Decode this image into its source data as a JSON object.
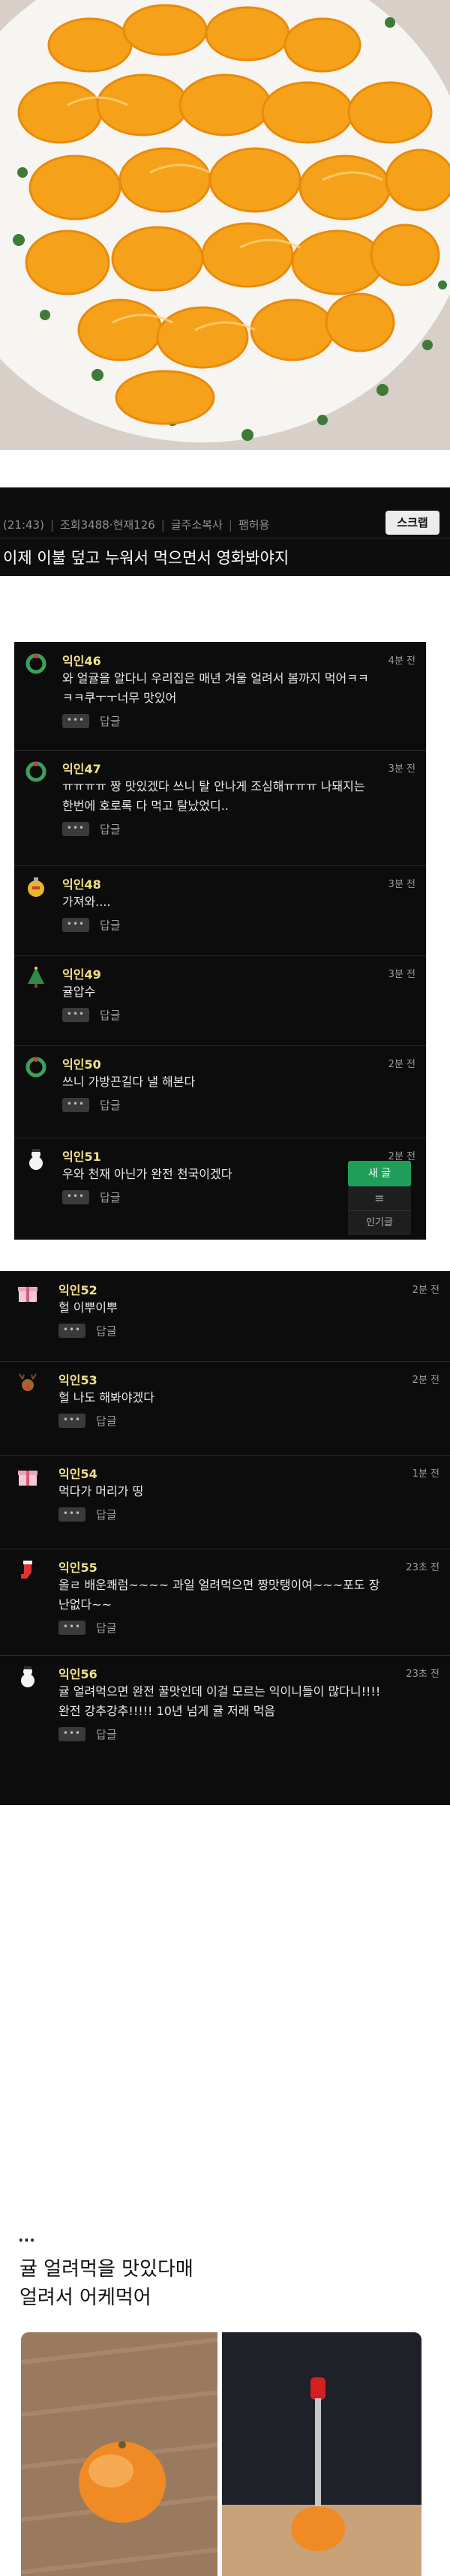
{
  "header": {
    "time": "(21:43)",
    "views": "조회3488",
    "members": "현재126",
    "copy_address": "글주소복사",
    "report": "팸허용",
    "scrap": "스크랩",
    "title": "이제 이불 덮고 누워서 먹으면서 영화봐야지"
  },
  "comments_a": [
    {
      "name": "익인46",
      "time": "4분 전",
      "lines": [
        "와 얼귤을 알다니 우리집은 매년 겨울 얼려서 봄까지 먹어ㅋㅋ",
        "ㅋㅋ쿠ㅜㅜ너무 맛있어"
      ],
      "avatar": "wreath-icon",
      "more": "•••",
      "reply": "답글"
    },
    {
      "name": "익인47",
      "time": "3분 전",
      "lines": [
        "ㅠㅠㅠㅠ 짱 맛있겠다 쓰니 탈 안나게 조심해ㅠㅠㅠ 나돼지는",
        "한번에 호로록 다 먹고 탈났었디.."
      ],
      "avatar": "wreath-icon",
      "more": "•••",
      "reply": "답글"
    },
    {
      "name": "익인48",
      "time": "3분 전",
      "lines": [
        "가져와...."
      ],
      "avatar": "ornament-icon",
      "more": "•••",
      "reply": "답글"
    },
    {
      "name": "익인49",
      "time": "3분 전",
      "lines": [
        "귤압수"
      ],
      "avatar": "tree-icon",
      "more": "•••",
      "reply": "답글"
    },
    {
      "name": "익인50",
      "time": "2분 전",
      "lines": [
        "쓰니 가방끈길다 낼 해본다"
      ],
      "avatar": "wreath-icon",
      "more": "•••",
      "reply": "답글"
    },
    {
      "name": "익인51",
      "time": "2분 전",
      "lines": [
        "우와 천재 아닌가 완전 천국이겠다"
      ],
      "avatar": "snowman-icon",
      "more": "•••",
      "reply": "답글"
    }
  ],
  "comments_b": [
    {
      "name": "익인52",
      "time": "2분 전",
      "lines": [
        "헐 이뿌이뿌"
      ],
      "avatar": "gift-icon",
      "more": "•••",
      "reply": "답글"
    },
    {
      "name": "익인53",
      "time": "2분 전",
      "lines": [
        "헐 나도 해봐야겠다"
      ],
      "avatar": "reindeer-icon",
      "more": "•••",
      "reply": "답글"
    },
    {
      "name": "익인54",
      "time": "1분 전",
      "lines": [
        "먹다가 머리가 띵"
      ],
      "avatar": "gift-icon",
      "more": "•••",
      "reply": "답글"
    },
    {
      "name": "익인55",
      "time": "23초 전",
      "lines": [
        "올ㄹ 배운쾌럼~~~~ 과일 얼려먹으면 짱맛탱이여~~~포도 장",
        "난없다~~"
      ],
      "avatar": "stocking-icon",
      "more": "•••",
      "reply": "답글"
    },
    {
      "name": "익인56",
      "time": "23초 전",
      "lines": [
        "귤 얼려먹으면 완전 꿀맛인데 이걸 모르는 익이니들이 많다니!!!!",
        "완전 강추강추!!!!! 10년 넘게 귤 저래 먹음"
      ],
      "avatar": "snowman-icon",
      "more": "•••",
      "reply": "답글"
    }
  ],
  "fab": {
    "new": "새 글",
    "menu": "≡",
    "popular": "인기글"
  },
  "bottom": {
    "dots": "...",
    "line1": "귤 얼려먹을 맛있다매",
    "line2": "얼려서 어케먹어"
  },
  "colors": {
    "panel_bg": "#0c0c0c",
    "nickname": "#f2e08a",
    "fab_green": "#1f9e5a"
  }
}
